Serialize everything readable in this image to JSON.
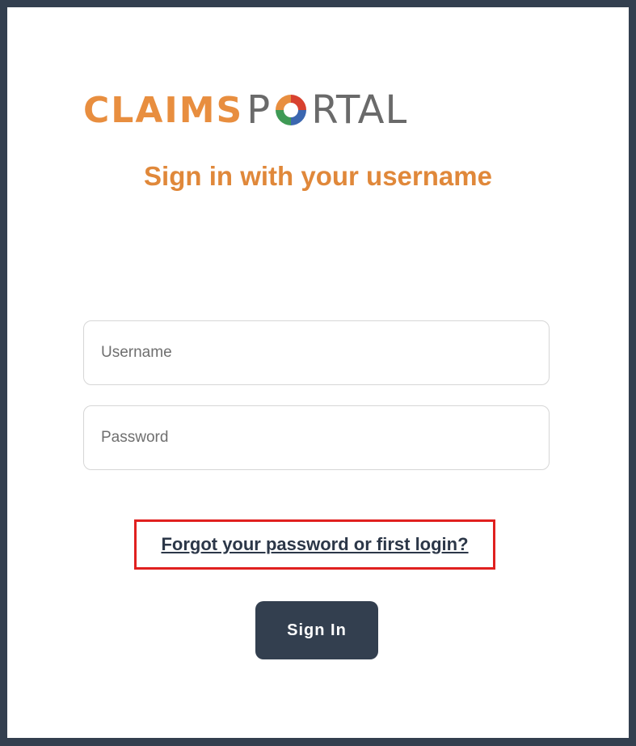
{
  "logo": {
    "part1": "CLAIMS",
    "part2_before_o": "P",
    "part2_after_o": "RTAL",
    "icon": "swirl-o-icon",
    "colors": {
      "claims": "#e88e3f",
      "portal": "#6a6a6a",
      "swirl_orange": "#e88e3f",
      "swirl_green": "#3f9a55",
      "swirl_red": "#d8412f",
      "swirl_blue": "#3b67b0"
    }
  },
  "headline": "Sign in with your username",
  "form": {
    "username_placeholder": "Username",
    "password_placeholder": "Password"
  },
  "forgot_link": "Forgot your password or first login?",
  "signin_label": "Sign In",
  "colors": {
    "background": "#333f4f",
    "accent": "#e0883a",
    "button": "#333f4f",
    "highlight_box": "#e0201f"
  }
}
